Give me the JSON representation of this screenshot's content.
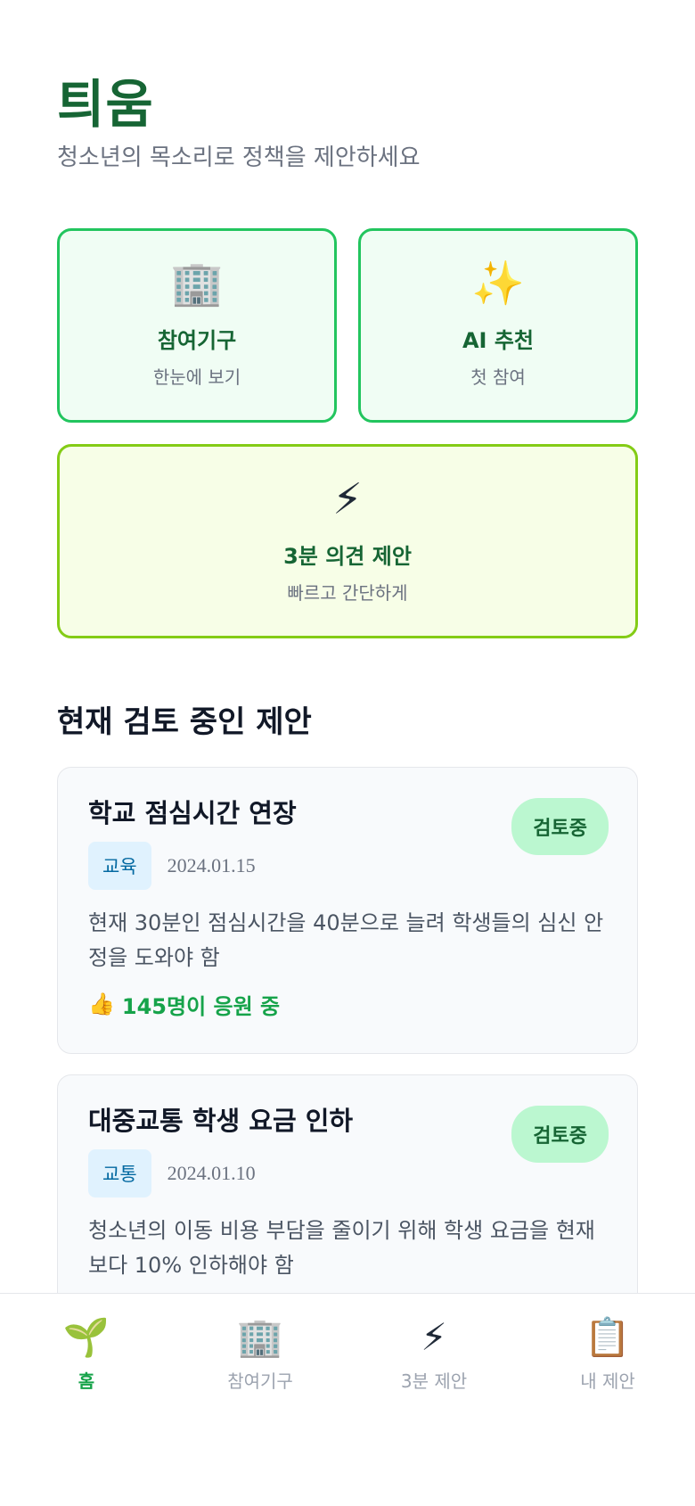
{
  "header": {
    "title": "틔움",
    "subtitle": "청소년의 목소리로 정책을 제안하세요"
  },
  "cards": {
    "agencies": {
      "icon": "🏢",
      "title": "참여기구",
      "subtitle": "한눈에 보기"
    },
    "ai": {
      "icon": "✨",
      "title": "AI 추천",
      "subtitle": "첫 참여"
    },
    "quick": {
      "icon": "⚡",
      "title": "3분 의견 제안",
      "subtitle": "빠르고 간단하게"
    }
  },
  "section": {
    "title": "현재 검토 중인 제안"
  },
  "proposals": [
    {
      "title": "학교 점심시간 연장",
      "status": "검토중",
      "category": "교육",
      "date": "2024.01.15",
      "description": "현재 30분인 점심시간을 40분으로 늘려 학생들의 심신 안정을 도와야 함",
      "support_icon": "👍",
      "support": "145명이 응원 중"
    },
    {
      "title": "대중교통 학생 요금 인하",
      "status": "검토중",
      "category": "교통",
      "date": "2024.01.10",
      "description": "청소년의 이동 비용 부담을 줄이기 위해 학생 요금을 현재보다 10% 인하해야 함"
    }
  ],
  "nav": {
    "items": [
      {
        "icon": "🌱",
        "label": "홈",
        "active": true
      },
      {
        "icon": "🏢",
        "label": "참여기구"
      },
      {
        "icon": "⚡",
        "label": "3분 제안"
      },
      {
        "icon": "📋",
        "label": "내 제안"
      }
    ]
  },
  "colors": {
    "brand": "#166534",
    "accent": "#22c55e",
    "lime": "#84cc16",
    "status_badge": "#bbf7d0",
    "category_tag": "#e0f2fe"
  }
}
